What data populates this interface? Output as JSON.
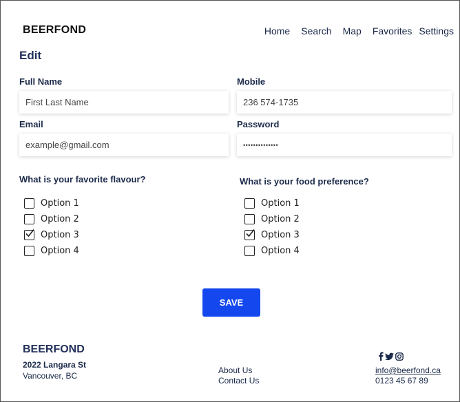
{
  "header": {
    "brand": "BEERFOND",
    "nav": [
      "Home",
      "Search",
      "Map",
      "Favorites",
      "Settings"
    ]
  },
  "page": {
    "title": "Edit"
  },
  "form": {
    "full_name": {
      "label": "Full Name",
      "placeholder": "First Last Name"
    },
    "mobile": {
      "label": "Mobile",
      "placeholder": "236 574-1735"
    },
    "email": {
      "label": "Email",
      "placeholder": "example@gmail.com"
    },
    "password": {
      "label": "Password",
      "value": "••••••••••••••"
    }
  },
  "flavour": {
    "question": "What is your favorite flavour?",
    "options": [
      {
        "label": "Option 1",
        "checked": false
      },
      {
        "label": "Option 2",
        "checked": false
      },
      {
        "label": "Option 3",
        "checked": true
      },
      {
        "label": "Option 4",
        "checked": false
      }
    ]
  },
  "food": {
    "question": "What is your food preference?",
    "options": [
      {
        "label": "Option 1",
        "checked": false
      },
      {
        "label": "Option 2",
        "checked": false
      },
      {
        "label": "Option 3",
        "checked": true
      },
      {
        "label": "Option 4",
        "checked": false
      }
    ]
  },
  "save_label": "SAVE",
  "footer": {
    "brand": "BEERFOND",
    "street": "2022 Langara St",
    "city": "Vancouver, BC",
    "links": [
      "About Us",
      "Contact Us"
    ],
    "social_icons": [
      "facebook-icon",
      "twitter-icon",
      "instagram-icon"
    ],
    "email": "info@beerfond.ca",
    "phone": "0123 45 67 89"
  }
}
